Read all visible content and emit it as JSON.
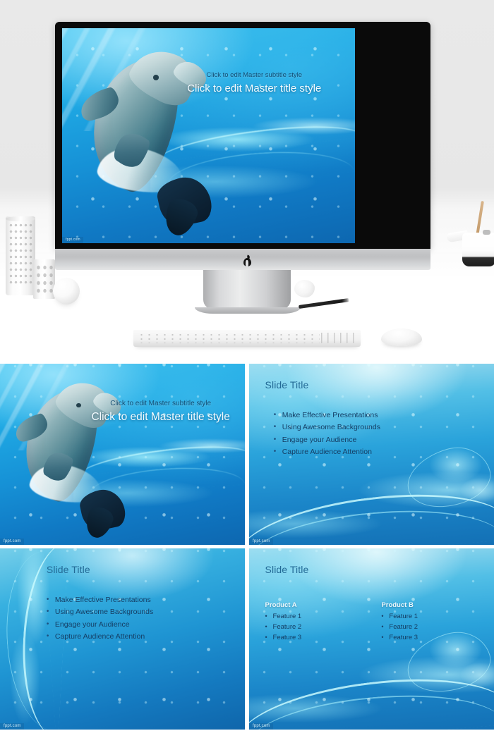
{
  "page": {
    "kind": "powerpoint-template-preview",
    "background_color": "#ffffff"
  },
  "hero_mockup": {
    "device": "imac-desktop-computer",
    "brand_icon": "apple-logo-icon",
    "desk_objects": [
      "perforated-vase-tall",
      "perforated-vase-short",
      "white-sphere-ornament",
      "white-teapot",
      "crumpled-paper-ball",
      "black-pencil",
      "apple-keyboard",
      "apple-magic-mouse"
    ],
    "screen_slide": {
      "subtitle": "Click to edit Master subtitle  style",
      "title": "Click to edit Master title style",
      "watermark": "fppt.com"
    }
  },
  "colors": {
    "page_background": "#e8e8e8",
    "desk": "#ffffff",
    "bezel": "#0a0a0a",
    "chin": "#c9cacc",
    "slide_blue_light": "#9fdcef",
    "slide_blue_mid": "#2aa3db",
    "slide_blue_deep": "#0d67b0",
    "slide_title_text": "#236a96",
    "bullet_text": "#153f66",
    "title_text": "#f4fbff",
    "subtitle_text": "#134d73",
    "column_head_text": "#eaf6fb",
    "watermark_text": "#cfe9f4"
  },
  "slides": [
    {
      "id": "slide-1-title",
      "layout": "title-with-dolphin",
      "subtitle": "Click to edit Master subtitle  style",
      "title": "Click to edit Master title style",
      "watermark": "fppt.com"
    },
    {
      "id": "slide-2-bullets",
      "layout": "title-and-content",
      "title": "Slide Title",
      "bullet_marker": "•",
      "bullets": [
        "Make Effective Presentations",
        "Using Awesome Backgrounds",
        "Engage your Audience",
        "Capture Audience Attention"
      ],
      "watermark": "fppt.com"
    },
    {
      "id": "slide-3-bullets-indent",
      "layout": "title-and-content-indented",
      "title": "Slide Title",
      "bullet_marker": "•",
      "bullets": [
        "Make Effective Presentations",
        "Using Awesome Backgrounds",
        "Engage your Audience",
        "Capture Audience Attention"
      ],
      "watermark": "fppt.com"
    },
    {
      "id": "slide-4-two-column",
      "layout": "two-column-comparison",
      "title": "Slide Title",
      "bullet_marker": "•",
      "columns": [
        {
          "heading": "Product A",
          "features": [
            "Feature 1",
            "Feature 2",
            "Feature 3"
          ]
        },
        {
          "heading": "Product B",
          "features": [
            "Feature 1",
            "Feature 2",
            "Feature 3"
          ]
        }
      ],
      "watermark": "fppt.com"
    }
  ]
}
